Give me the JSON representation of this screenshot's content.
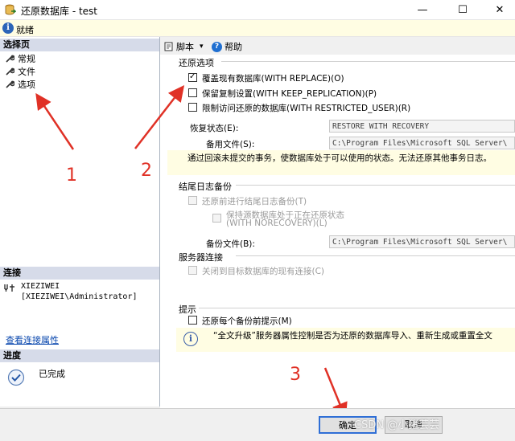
{
  "window": {
    "title": "还原数据库 - test",
    "controls": {
      "minimize": "—",
      "maximize": "☐",
      "close": "✕"
    }
  },
  "status": {
    "icon": "info-icon",
    "text": "就绪"
  },
  "left": {
    "select_page_header": "选择页",
    "pages": [
      {
        "label": "常规",
        "icon": "wrench-icon"
      },
      {
        "label": "文件",
        "icon": "wrench-icon"
      },
      {
        "label": "选项",
        "icon": "wrench-icon"
      }
    ],
    "connection_header": "连接",
    "connection_server": "XIEZIWEI",
    "connection_user": "[XIEZIWEI\\Administrator]",
    "view_connection_link": "查看连接属性",
    "progress_header": "进度",
    "progress_text": "已完成"
  },
  "toolbar": {
    "script_label": "脚本",
    "script_arrow": "▾",
    "help_label": "帮助",
    "help_glyph": "?"
  },
  "restore_options": {
    "header": "还原选项",
    "options": [
      {
        "label": "覆盖现有数据库(WITH REPLACE)(O)",
        "checked": true
      },
      {
        "label": "保留复制设置(WITH KEEP_REPLICATION)(P)",
        "checked": false
      },
      {
        "label": "限制访问还原的数据库(WITH RESTRICTED_USER)(R)",
        "checked": false
      }
    ],
    "recovery_state_label": "恢复状态(E):",
    "recovery_state_value": "RESTORE WITH RECOVERY",
    "standby_file_label": "备用文件(S):",
    "standby_file_value": "C:\\Program Files\\Microsoft SQL Server\\",
    "note": "通过回滚未提交的事务，使数据库处于可以使用的状态。无法还原其他事务日志。"
  },
  "tail_log": {
    "header": "结尾日志备份",
    "backup_before_restore": "还原前进行结尾日志备份(T)",
    "leave_restoring_line1": "保持源数据库处于正在还原状态",
    "leave_restoring_line2": "(WITH NORECOVERY)(L)",
    "backup_file_label": "备份文件(B):",
    "backup_file_value": "C:\\Program Files\\Microsoft SQL Server\\"
  },
  "server_connections": {
    "header": "服务器连接",
    "close_existing": "关闭到目标数据库的现有连接(C)"
  },
  "prompt": {
    "header": "提示",
    "prompt_each_backup": "还原每个备份前提示(M)",
    "info_glyph": "i",
    "info_text": "“全文升级”服务器属性控制是否为还原的数据库导入、重新生成或重置全文"
  },
  "annotations": [
    "1",
    "2",
    "3"
  ],
  "buttons": {
    "ok": "确定",
    "cancel": "取消"
  },
  "watermark": "CSDN @小猪芸芸"
}
